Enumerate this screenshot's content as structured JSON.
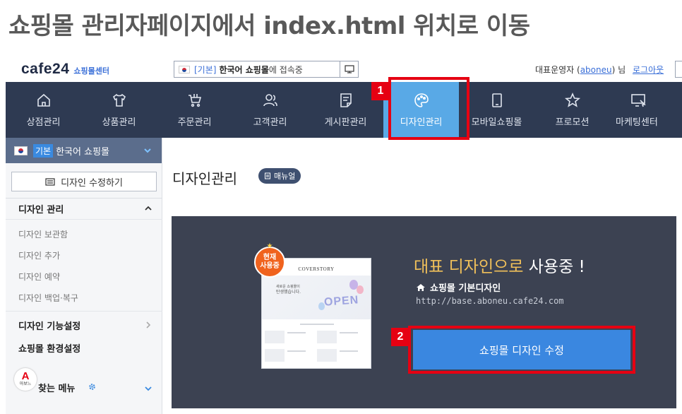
{
  "headline": "쇼핑몰 관리자페이지에서 index.html 위치로 이동",
  "topbar": {
    "logo_main": "cafe24",
    "logo_sub": "쇼핑몰센터",
    "lang_prefix": "[기본]",
    "lang_strong": "한국어 쇼핑몰",
    "lang_rest": "에 접속중",
    "admin_label": "대표운영자 (",
    "admin_id": "aboneu",
    "admin_suffix": ") 님",
    "logout": "로그아웃"
  },
  "gnb": {
    "items": [
      {
        "label": "상점관리",
        "icon": "home-icon"
      },
      {
        "label": "상품관리",
        "icon": "shirt-icon"
      },
      {
        "label": "주문관리",
        "icon": "cart-icon"
      },
      {
        "label": "고객관리",
        "icon": "users-icon"
      },
      {
        "label": "게시판관리",
        "icon": "board-icon"
      },
      {
        "label": "디자인관리",
        "icon": "palette-icon"
      },
      {
        "label": "모바일쇼핑몰",
        "icon": "mobile-icon"
      },
      {
        "label": "프로모션",
        "icon": "star-icon"
      },
      {
        "label": "마케팅센터",
        "icon": "monitor-cursor-icon"
      }
    ]
  },
  "badges": {
    "step1": "1",
    "step2": "2"
  },
  "sidebar": {
    "shop_tag": "기본",
    "shop_name": "한국어 쇼핑몰",
    "edit_button": "디자인 수정하기",
    "group_design": "디자인 관리",
    "sub_items": [
      "디자인 보관함",
      "디자인 추가",
      "디자인 예약",
      "디자인 백업·복구"
    ],
    "group_features": "디자인 기능설정",
    "group_env": "쇼핑몰 환경설정",
    "fav_logo_letter": "A",
    "fav_logo_text": "아보느",
    "fav_title": "찾는 메뉴"
  },
  "main": {
    "title": "디자인관리",
    "manual_label": "매뉴얼",
    "thumb": {
      "brand": "COVERSTORY",
      "line1": "새로운 쇼핑몰이",
      "line2": "탄생했습니다.",
      "open": "OPEN"
    },
    "now_badge_line1": "현재",
    "now_badge_line2": "사용중",
    "rep_accent": "대표 디자인으로",
    "rep_rest": " 사용중 !",
    "rep_design_name": "쇼핑몰 기본디자인",
    "rep_url": "http://base.aboneu.cafe24.com",
    "edit_shop_button": "쇼핑몰 디자인 수정"
  },
  "colors": {
    "nav_bg": "#2e3a52",
    "nav_active": "#59a9e6",
    "highlight_red": "#e60012",
    "panel_bg": "#3c4252",
    "primary_button": "#3a87e0",
    "accent_gold": "#f0c05a"
  }
}
